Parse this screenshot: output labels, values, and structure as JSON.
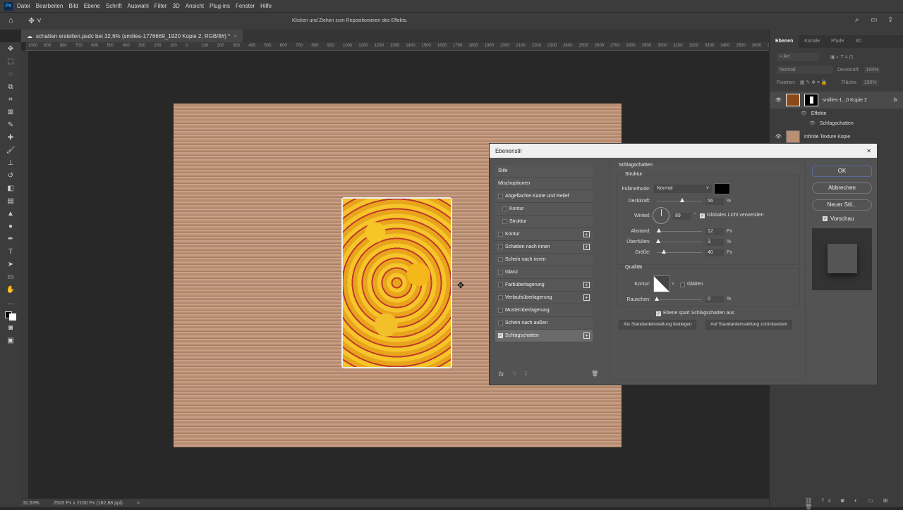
{
  "menubar": {
    "logo": "Ps",
    "items": [
      "Datei",
      "Bearbeiten",
      "Bild",
      "Ebene",
      "Schrift",
      "Auswahl",
      "Filter",
      "3D",
      "Ansicht",
      "Plug-ins",
      "Fenster",
      "Hilfe"
    ]
  },
  "options_bar": {
    "hint": "Klicken und Ziehen zum Repositionieren des Effekts."
  },
  "document_tab": {
    "title": "schatten erstellen.psdc bei 32,6% (smilies-1776669_1920 Kopie 2, RGB/8#) *",
    "close": "×"
  },
  "ruler_labels": [
    "1000",
    "900",
    "800",
    "700",
    "600",
    "500",
    "400",
    "300",
    "200",
    "100",
    "0",
    "100",
    "200",
    "300",
    "400",
    "500",
    "600",
    "700",
    "800",
    "900",
    "1000",
    "1100",
    "1200",
    "1300",
    "1400",
    "1500",
    "1600",
    "1700",
    "1800",
    "1900",
    "2000",
    "2100",
    "2200",
    "2300",
    "2400",
    "2500",
    "2600",
    "2700",
    "2800",
    "2900",
    "3000",
    "3100",
    "3200",
    "3300",
    "3400",
    "3500",
    "3600",
    "3700"
  ],
  "status": {
    "zoom": "32,63%",
    "doc_size": "2920 Px x 2160 Px (182,88 ppi)",
    "arrow": ">"
  },
  "layers_panel": {
    "tabs": [
      "Ebenen",
      "Kanäle",
      "Pfade",
      "3D"
    ],
    "search_placeholder": "Art",
    "blend_mode": "Normal",
    "opacity_label": "Deckkraft:",
    "opacity": "100%",
    "lock_label": "Fixieren:",
    "fill_label": "Fläche:",
    "fill": "100%",
    "layers": [
      {
        "name": "smilies-1...0 Kopie 2",
        "fx": "fx",
        "selected": true
      },
      {
        "name": "Infinite Texture Kopie",
        "selected": false
      }
    ],
    "effects_label": "Effekte",
    "effect_item": "Schlagschatten"
  },
  "dialog": {
    "title": "Ebenenstil",
    "close": "✕",
    "styles": [
      {
        "label": "Stile",
        "cb": false,
        "hascb": false
      },
      {
        "label": "Mischoptionen",
        "hascb": false
      },
      {
        "label": "Abgeflachte Kante und Relief",
        "hascb": true,
        "checked": false
      },
      {
        "label": "Kontur",
        "hascb": true,
        "checked": false,
        "indent": true
      },
      {
        "label": "Struktur",
        "hascb": true,
        "checked": false,
        "indent": true
      },
      {
        "label": "Kontur",
        "hascb": true,
        "checked": false,
        "plus": true
      },
      {
        "label": "Schatten nach innen",
        "hascb": true,
        "checked": false,
        "plus": true
      },
      {
        "label": "Schein nach innen",
        "hascb": true,
        "checked": false
      },
      {
        "label": "Glanz",
        "hascb": true,
        "checked": false
      },
      {
        "label": "Farbüberlagerung",
        "hascb": true,
        "checked": false,
        "plus": true
      },
      {
        "label": "Verlaufsüberlagerung",
        "hascb": true,
        "checked": false,
        "plus": true
      },
      {
        "label": "Musterüberlagerung",
        "hascb": true,
        "checked": false
      },
      {
        "label": "Schein nach außen",
        "hascb": true,
        "checked": false
      },
      {
        "label": "Schlagschatten",
        "hascb": true,
        "checked": true,
        "plus": true,
        "selected": true
      }
    ],
    "fx_label": "fx",
    "section_title": "Schlagschatten",
    "structure_title": "Struktur",
    "blend_label": "Füllmethode:",
    "blend_value": "Normal",
    "shadow_color": "#000000",
    "opacity_label": "Deckkraft:",
    "opacity": 56,
    "opacity_unit": "%",
    "angle_label": "Winkel:",
    "angle": "89",
    "angle_unit": "°",
    "global_light": "Globales Licht verwenden",
    "global_light_checked": true,
    "distance_label": "Abstand:",
    "distance": 12,
    "distance_unit": "Px",
    "spread_label": "Überfüllen:",
    "spread": 3,
    "spread_unit": "%",
    "size_label": "Größe:",
    "size": 40,
    "size_unit": "Px",
    "quality_title": "Qualität",
    "contour_label": "Kontur:",
    "antialias": "Glätten",
    "antialias_checked": false,
    "noise_label": "Rauschen:",
    "noise": 0,
    "noise_unit": "%",
    "knockout": "Ebene spart Schlagschatten aus",
    "knockout_checked": true,
    "make_default": "Als Standardeinstellung festlegen",
    "reset_default": "Auf Standardeinstellung zurücksetzen",
    "ok": "OK",
    "cancel": "Abbrechen",
    "new_style": "Neuer Stil...",
    "preview": "Vorschau",
    "preview_checked": true
  }
}
